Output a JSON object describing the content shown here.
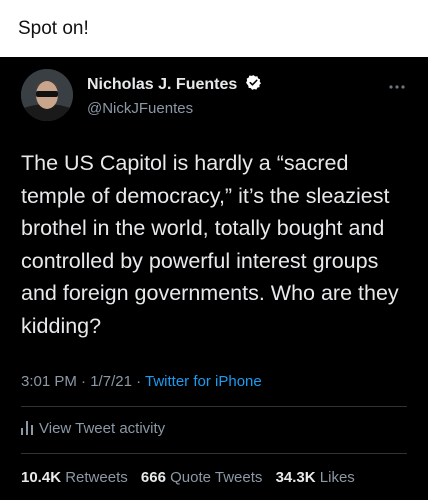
{
  "caption": "Spot on!",
  "tweet": {
    "display_name": "Nicholas J. Fuentes",
    "handle": "@NickJFuentes",
    "text": "The US Capitol is hardly a “sacred temple of democracy,” it’s the sleaziest brothel in the world, totally bought and controlled by powerful interest groups and foreign governments. Who are they kidding?",
    "time": "3:01 PM",
    "date": "1/7/21",
    "separator": " · ",
    "source": "Twitter for iPhone",
    "activity_label": "View Tweet activity",
    "stats": {
      "retweets_count": "10.4K",
      "retweets_label": "Retweets",
      "quotes_count": "666",
      "quotes_label": "Quote Tweets",
      "likes_count": "34.3K",
      "likes_label": "Likes"
    },
    "more_icon": "more-options-icon",
    "verified_icon": "verified-badge-icon",
    "colors": {
      "background": "#000000",
      "text": "#e7e9ea",
      "secondary": "#8b98a5",
      "link": "#1d9bf0"
    }
  }
}
